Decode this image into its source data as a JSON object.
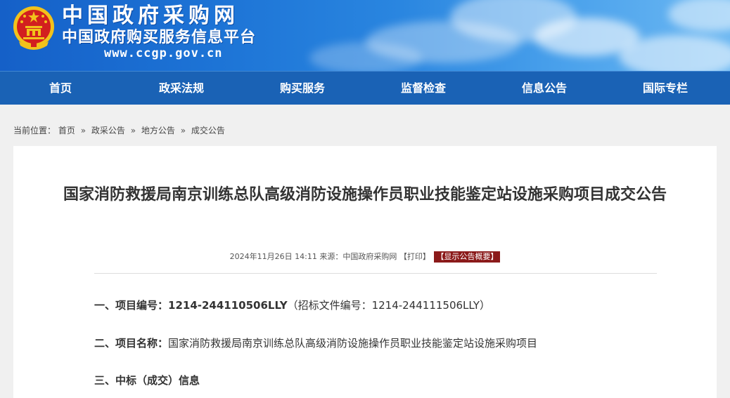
{
  "header": {
    "title": "中国政府采购网",
    "subtitle": "中国政府购买服务信息平台",
    "url": "www.ccgp.gov.cn",
    "colors": {
      "banner_start": "#1560c8",
      "banner_end": "#6cb8f2",
      "nav_bg": "#1a62b5",
      "emblem_red": "#d21f1f",
      "emblem_gold": "#f2c21b"
    }
  },
  "nav": {
    "items": [
      {
        "label": "首页"
      },
      {
        "label": "政采法规"
      },
      {
        "label": "购买服务"
      },
      {
        "label": "监督检查"
      },
      {
        "label": "信息公告"
      },
      {
        "label": "国际专栏"
      }
    ]
  },
  "breadcrumb": {
    "prefix": "当前位置：",
    "items": [
      "首页",
      "政采公告",
      "地方公告",
      "成交公告"
    ],
    "separator": "»"
  },
  "article": {
    "title": "国家消防救援局南京训练总队高级消防设施操作员职业技能鉴定站设施采购项目成交公告",
    "meta": {
      "datetime": "2024年11月26日 14:11",
      "source_label": "来源：",
      "source": "中国政府采购网",
      "print_label": "【打印】",
      "summary_label": "【显示公告概要】",
      "summary_color": "#8b1a1a"
    },
    "sections": [
      {
        "label": "一、项目编号：",
        "value": "1214-244110506LLY",
        "extra": "（招标文件编号：1214-244111506LLY）"
      },
      {
        "label": "二、项目名称：",
        "value": "国家消防救援局南京训练总队高级消防设施操作员职业技能鉴定站设施采购项目"
      },
      {
        "label": "三、中标（成交）信息"
      }
    ]
  }
}
